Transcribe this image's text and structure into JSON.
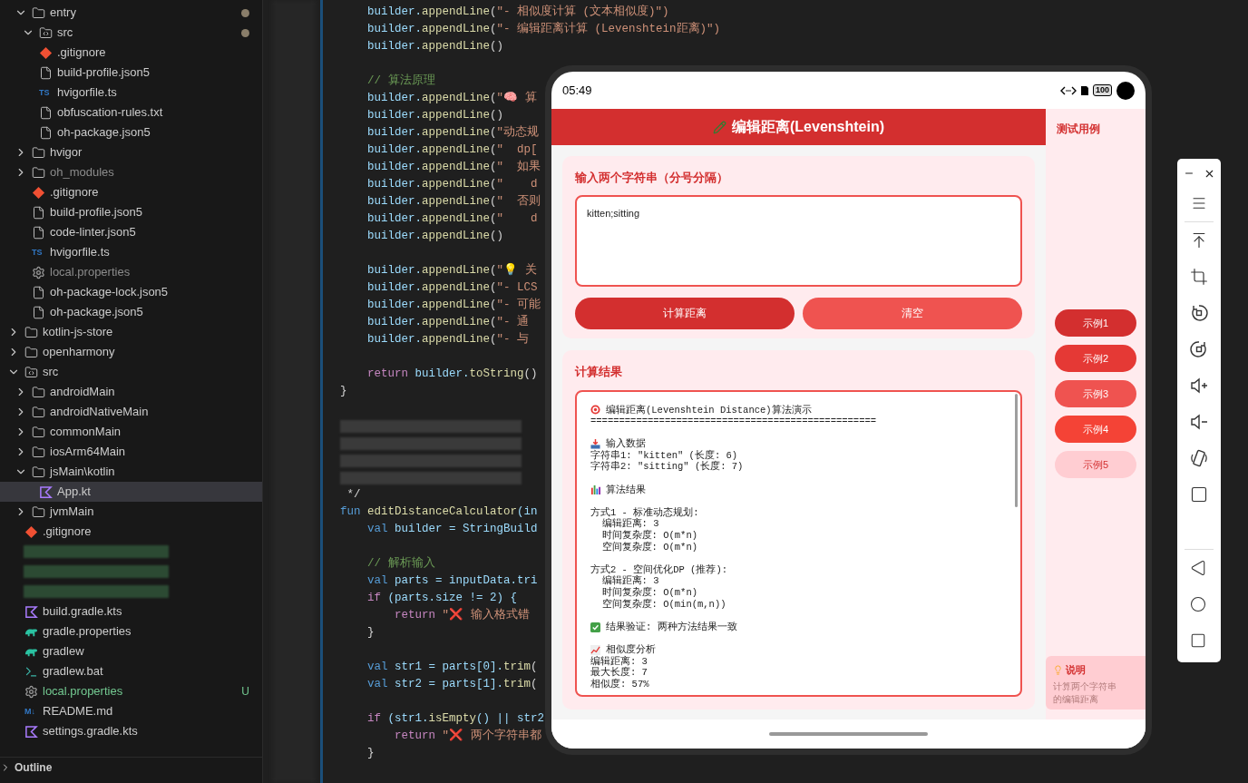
{
  "explorer": {
    "scrolled_folder_contents": [
      {
        "label": "entry",
        "kind": "folder",
        "expanded": true,
        "modified": true,
        "children": [
          {
            "label": "src",
            "kind": "folder-src",
            "expanded": true,
            "modified": true
          },
          {
            "label": ".gitignore",
            "kind": "git"
          },
          {
            "label": "build-profile.json5",
            "kind": "file"
          },
          {
            "label": "hvigorfile.ts",
            "kind": "ts",
            "icon_label": "TS"
          },
          {
            "label": "obfuscation-rules.txt",
            "kind": "file"
          },
          {
            "label": "oh-package.json5",
            "kind": "file"
          }
        ]
      },
      {
        "label": "hvigor",
        "kind": "folder",
        "expanded": false
      },
      {
        "label": "oh_modules",
        "kind": "folder",
        "expanded": false,
        "ignored": true
      },
      {
        "label": ".gitignore",
        "kind": "git"
      },
      {
        "label": "build-profile.json5",
        "kind": "file"
      },
      {
        "label": "code-linter.json5",
        "kind": "file"
      },
      {
        "label": "hvigorfile.ts",
        "kind": "ts",
        "icon_label": "TS"
      },
      {
        "label": "local.properties",
        "kind": "gear",
        "ignored": true
      },
      {
        "label": "oh-package-lock.json5",
        "kind": "file"
      },
      {
        "label": "oh-package.json5",
        "kind": "file"
      }
    ],
    "items": [
      {
        "label": "kotlin-js-store",
        "kind": "folder",
        "expanded": false
      },
      {
        "label": "openharmony",
        "kind": "folder",
        "expanded": false
      },
      {
        "label": "src",
        "kind": "folder-src",
        "expanded": true,
        "children": [
          {
            "label": "androidMain",
            "kind": "folder",
            "expanded": false
          },
          {
            "label": "androidNativeMain",
            "kind": "folder",
            "expanded": false
          },
          {
            "label": "commonMain",
            "kind": "folder",
            "expanded": false
          },
          {
            "label": "iosArm64Main",
            "kind": "folder",
            "expanded": false
          },
          {
            "label": "jsMain\\kotlin",
            "kind": "folder",
            "expanded": true,
            "children": [
              {
                "label": "App.kt",
                "kind": "kotlin",
                "selected": true
              }
            ]
          },
          {
            "label": "jvmMain",
            "kind": "folder",
            "expanded": false
          }
        ]
      },
      {
        "label": ".gitignore",
        "kind": "git"
      },
      {
        "kind": "redacted"
      },
      {
        "kind": "redacted"
      },
      {
        "kind": "redacted"
      },
      {
        "label": "build.gradle.kts",
        "kind": "kotlin"
      },
      {
        "label": "gradle.properties",
        "kind": "gradle"
      },
      {
        "label": "gradlew",
        "kind": "gradle"
      },
      {
        "label": "gradlew.bat",
        "kind": "terminal"
      },
      {
        "label": "local.properties",
        "kind": "gear",
        "untracked": true,
        "status_letter": "U"
      },
      {
        "label": "README.md",
        "kind": "markdown",
        "icon_label": "M↓"
      },
      {
        "label": "settings.gradle.kts",
        "kind": "kotlin"
      }
    ],
    "outline": {
      "label": "Outline",
      "expanded": false
    }
  },
  "editor": {
    "blocks": [
      [
        {
          "text": "    builder.appendLine(\"- 相似度计算 (文本相似度)\")"
        },
        {
          "text": "    builder.appendLine(\"- 编辑距离计算 (Levenshtein距离)\")"
        },
        {
          "text": "    builder.appendLine()"
        }
      ],
      [
        {
          "text": "    // 算法原理"
        },
        {
          "text": "    builder.appendLine(\"🧠 算"
        },
        {
          "text": "    builder.appendLine()"
        },
        {
          "text": "    builder.appendLine(\"动态规"
        },
        {
          "text": "    builder.appendLine(\"  dp["
        },
        {
          "text": "    builder.appendLine(\"  如果"
        },
        {
          "text": "    builder.appendLine(\"    d"
        },
        {
          "text": "    builder.appendLine(\"  否则"
        },
        {
          "text": "    builder.appendLine(\"    d"
        },
        {
          "text": "    builder.appendLine()"
        }
      ],
      [
        {
          "text": "    builder.appendLine(\"💡 关"
        },
        {
          "text": "    builder.appendLine(\"- LCS"
        },
        {
          "text": "    builder.appendLine(\"- 可能"
        },
        {
          "text": "    builder.appendLine(\"- 通"
        },
        {
          "text": "    builder.appendLine(\"- 与"
        }
      ],
      [
        {
          "text": "    return builder.toString()"
        },
        {
          "text": "}"
        }
      ],
      [
        {
          "kind": "redacted"
        },
        {
          "kind": "redacted"
        },
        {
          "kind": "redacted"
        },
        {
          "kind": "redacted"
        },
        {
          "text": " */"
        },
        {
          "text": "fun editDistanceCalculator(in"
        },
        {
          "text": "    val builder = StringBuild"
        }
      ],
      [
        {
          "text": "    // 解析输入"
        },
        {
          "text": "    val parts = inputData.tri"
        },
        {
          "text": "    if (parts.size != 2) {"
        },
        {
          "text": "        return \"❌ 输入格式错"
        },
        {
          "text": "    }"
        }
      ],
      [
        {
          "text": "    val str1 = parts[0].trim("
        },
        {
          "text": "    val str2 = parts[1].trim("
        }
      ],
      [
        {
          "text": "    if (str1.isEmpty() || str2"
        },
        {
          "text": "        return \"❌ 两个字符串都"
        },
        {
          "text": "    }"
        }
      ]
    ]
  },
  "phone": {
    "status_bar": {
      "time": "05:49",
      "battery": "100"
    },
    "app": {
      "title": "编辑距离(Levenshtein)",
      "input_card": {
        "label": "输入两个字符串（分号分隔）",
        "value": "kitten;sitting"
      },
      "buttons": [
        {
          "label": "计算距离",
          "kind": "primary"
        },
        {
          "label": "清空",
          "kind": "secondary"
        }
      ],
      "result_card": {
        "title": "计算结果",
        "blocks": [
          [
            {
              "text": "编辑距离(Levenshtein Distance)算法演示",
              "kind": "target"
            },
            {
              "text": "=================================================="
            }
          ],
          [
            {
              "text": "输入数据",
              "kind": "inbox"
            },
            {
              "text": "字符串1: \"kitten\" (长度: 6)"
            },
            {
              "text": "字符串2: \"sitting\" (长度: 7)"
            }
          ],
          [
            {
              "text": "算法结果",
              "kind": "chart"
            }
          ],
          [
            {
              "text": "方式1 - 标准动态规划:"
            },
            {
              "text": "  编辑距离: 3"
            },
            {
              "text": "  时间复杂度: O(m*n)"
            },
            {
              "text": "  空间复杂度: O(m*n)"
            }
          ],
          [
            {
              "text": "方式2 - 空间优化DP (推荐):"
            },
            {
              "text": "  编辑距离: 3"
            },
            {
              "text": "  时间复杂度: O(m*n)"
            },
            {
              "text": "  空间复杂度: O(min(m,n))"
            }
          ],
          [
            {
              "text": "结果验证: 两种方法结果一致",
              "kind": "check"
            }
          ],
          [
            {
              "text": "相似度分析",
              "kind": "trend"
            },
            {
              "text": "编辑距离: 3"
            },
            {
              "text": "最大长度: 7"
            },
            {
              "text": "相似度: 57%"
            }
          ]
        ]
      },
      "side": {
        "title": "测试用例",
        "examples": [
          {
            "label": "示例1",
            "color": "#d32f2f"
          },
          {
            "label": "示例2",
            "color": "#e53935"
          },
          {
            "label": "示例3",
            "color": "#ef5350"
          },
          {
            "label": "示例4",
            "color": "#f44336"
          },
          {
            "label": "示例5",
            "color": "#ffcdd2"
          }
        ],
        "info": {
          "title": "说明",
          "text": "计算两个字符串的编辑距离"
        }
      }
    }
  }
}
